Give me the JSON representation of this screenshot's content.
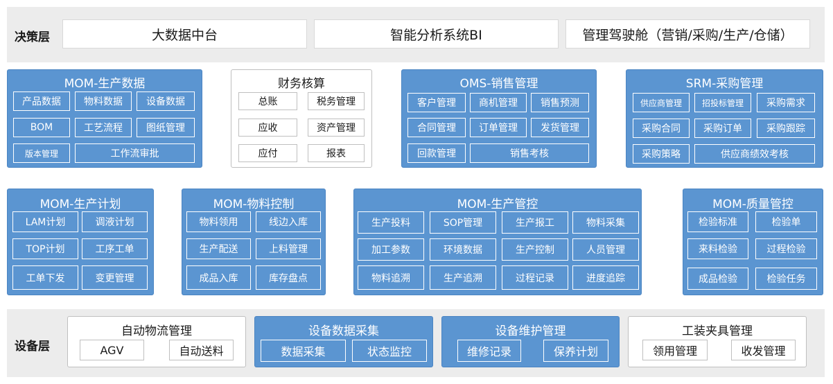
{
  "decision_layer": {
    "label": "决策层",
    "items": [
      "大数据中台",
      "智能分析系统BI",
      "管理驾驶舱（营销/采购/生产/仓储）"
    ]
  },
  "row1": {
    "mom_data": {
      "title": "MOM-生产数据",
      "items": [
        "产品数据",
        "物料数据",
        "设备数据",
        "BOM",
        "工艺流程",
        "图纸管理",
        "版本管理",
        "工作流审批"
      ]
    },
    "finance": {
      "title": "财务核算",
      "items": [
        "总账",
        "税务管理",
        "应收",
        "资产管理",
        "应付",
        "报表"
      ]
    },
    "oms": {
      "title": "OMS-销售管理",
      "items": [
        "客户管理",
        "商机管理",
        "销售预测",
        "合同管理",
        "订单管理",
        "发货管理",
        "回款管理",
        "销售考核"
      ]
    },
    "srm": {
      "title": "SRM-采购管理",
      "items": [
        "供应商管理",
        "招投标管理",
        "采购需求",
        "采购合同",
        "采购订单",
        "采购跟踪",
        "采购策略",
        "供应商绩效考核"
      ]
    }
  },
  "row2": {
    "plan": {
      "title": "MOM-生产计划",
      "items": [
        "LAM计划",
        "调液计划",
        "TOP计划",
        "工序工单",
        "工单下发",
        "变更管理"
      ]
    },
    "material": {
      "title": "MOM-物料控制",
      "items": [
        "物料领用",
        "线边入库",
        "生产配送",
        "上料管理",
        "成品入库",
        "库存盘点"
      ]
    },
    "control": {
      "title": "MOM-生产管控",
      "items": [
        "生产投料",
        "SOP管理",
        "生产报工",
        "物料采集",
        "加工参数",
        "环境数据",
        "生产控制",
        "人员管理",
        "物料追溯",
        "生产追溯",
        "过程记录",
        "进度追踪"
      ]
    },
    "quality": {
      "title": "MOM-质量管控",
      "items": [
        "检验标准",
        "检验单",
        "来料检验",
        "过程检验",
        "成品检验",
        "检验任务"
      ]
    }
  },
  "device_layer": {
    "label": "设备层",
    "logistics": {
      "title": "自动物流管理",
      "items": [
        "AGV",
        "自动送料"
      ]
    },
    "collect": {
      "title": "设备数据采集",
      "items": [
        "数据采集",
        "状态监控"
      ]
    },
    "maintain": {
      "title": "设备维护管理",
      "items": [
        "维修记录",
        "保养计划"
      ]
    },
    "tooling": {
      "title": "工装夹具管理",
      "items": [
        "领用管理",
        "收发管理"
      ]
    }
  },
  "colors": {
    "panel_blue": "#5b95d1",
    "band_gray": "#ececec",
    "border_gray": "#bfbfbf"
  }
}
